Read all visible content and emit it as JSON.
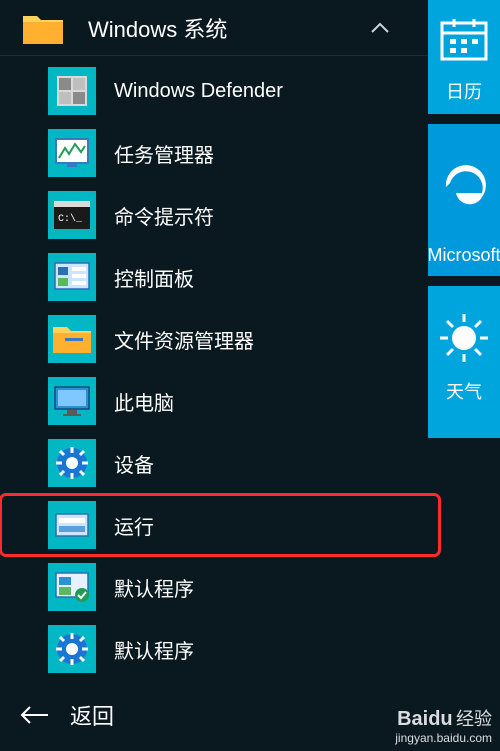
{
  "folder": {
    "title": "Windows 系统"
  },
  "items": [
    {
      "label": "Windows Defender"
    },
    {
      "label": "任务管理器"
    },
    {
      "label": "命令提示符"
    },
    {
      "label": "控制面板"
    },
    {
      "label": "文件资源管理器"
    },
    {
      "label": "此电脑"
    },
    {
      "label": "设备"
    },
    {
      "label": "运行"
    },
    {
      "label": "默认程序"
    },
    {
      "label": "默认程序"
    }
  ],
  "back": {
    "label": "返回"
  },
  "tiles": {
    "calendar": {
      "label": "日历"
    },
    "edge": {
      "label": "Microsoft"
    },
    "weather": {
      "label": "天气"
    }
  },
  "watermark": {
    "brand": "Baidu",
    "cn": "经验",
    "url": "jingyan.baidu.com"
  }
}
